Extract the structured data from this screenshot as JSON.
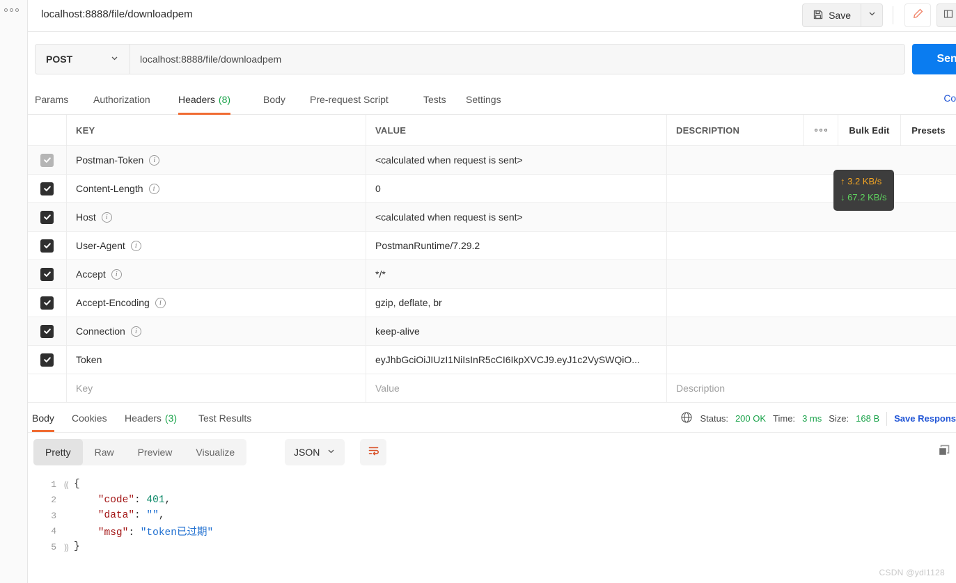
{
  "window": {
    "tab_title": "localhost:8888/file/downloadpem",
    "save_label": "Save"
  },
  "request": {
    "method": "POST",
    "url": "localhost:8888/file/downloadpem",
    "send_label": "Send",
    "tabs": [
      {
        "label": "Params",
        "active": false
      },
      {
        "label": "Authorization",
        "active": false
      },
      {
        "label": "Headers",
        "count": "(8)",
        "active": true
      },
      {
        "label": "Body",
        "active": false
      },
      {
        "label": "Pre-request Script",
        "active": false
      },
      {
        "label": "Tests",
        "active": false
      },
      {
        "label": "Settings",
        "active": false
      }
    ],
    "cookies_link": "Coo"
  },
  "headers_table": {
    "columns": {
      "key": "KEY",
      "value": "VALUE",
      "description": "DESCRIPTION",
      "bulk_edit": "Bulk Edit",
      "presets": "Presets"
    },
    "rows": [
      {
        "checked": true,
        "dim": true,
        "info": true,
        "key": "Postman-Token",
        "value": "<calculated when request is sent>",
        "description": ""
      },
      {
        "checked": true,
        "dim": false,
        "info": true,
        "key": "Content-Length",
        "value": "0",
        "description": ""
      },
      {
        "checked": true,
        "dim": false,
        "info": true,
        "key": "Host",
        "value": "<calculated when request is sent>",
        "description": ""
      },
      {
        "checked": true,
        "dim": false,
        "info": true,
        "key": "User-Agent",
        "value": "PostmanRuntime/7.29.2",
        "description": ""
      },
      {
        "checked": true,
        "dim": false,
        "info": true,
        "key": "Accept",
        "value": "*/*",
        "description": ""
      },
      {
        "checked": true,
        "dim": false,
        "info": true,
        "key": "Accept-Encoding",
        "value": "gzip, deflate, br",
        "description": ""
      },
      {
        "checked": true,
        "dim": false,
        "info": true,
        "key": "Connection",
        "value": "keep-alive",
        "description": ""
      },
      {
        "checked": true,
        "dim": false,
        "info": false,
        "key": "Token",
        "value": "eyJhbGciOiJIUzI1NiIsInR5cCI6IkpXVCJ9.eyJ1c2VySWQiO...",
        "description": ""
      }
    ],
    "placeholder_row": {
      "key": "Key",
      "value": "Value",
      "description": "Description"
    }
  },
  "network_tooltip": {
    "upload": "3.2 KB/s",
    "download": "67.2 KB/s",
    "upload_color": "#f5a623",
    "download_color": "#5fd35f"
  },
  "response": {
    "tabs": [
      {
        "label": "Body",
        "active": true
      },
      {
        "label": "Cookies",
        "active": false
      },
      {
        "label": "Headers",
        "count": "(3)",
        "active": false
      },
      {
        "label": "Test Results",
        "active": false
      }
    ],
    "status_label": "Status:",
    "status_value": "200 OK",
    "time_label": "Time:",
    "time_value": "3 ms",
    "size_label": "Size:",
    "size_value": "168 B",
    "save_response": "Save Respons",
    "view_modes": [
      {
        "label": "Pretty",
        "active": true
      },
      {
        "label": "Raw",
        "active": false
      },
      {
        "label": "Preview",
        "active": false
      },
      {
        "label": "Visualize",
        "active": false
      }
    ],
    "format": "JSON",
    "body_lines": [
      {
        "num": "1",
        "fold": "⸨",
        "segments": [
          {
            "t": "{",
            "c": "p"
          }
        ]
      },
      {
        "num": "2",
        "fold": "",
        "segments": [
          {
            "t": "    \"code\"",
            "c": "k"
          },
          {
            "t": ": ",
            "c": "p"
          },
          {
            "t": "401",
            "c": "n"
          },
          {
            "t": ",",
            "c": "p"
          }
        ]
      },
      {
        "num": "3",
        "fold": "",
        "segments": [
          {
            "t": "    \"data\"",
            "c": "k"
          },
          {
            "t": ": ",
            "c": "p"
          },
          {
            "t": "\"\"",
            "c": "s"
          },
          {
            "t": ",",
            "c": "p"
          }
        ]
      },
      {
        "num": "4",
        "fold": "",
        "segments": [
          {
            "t": "    \"msg\"",
            "c": "k"
          },
          {
            "t": ": ",
            "c": "p"
          },
          {
            "t": "\"token已过期\"",
            "c": "s"
          }
        ]
      },
      {
        "num": "5",
        "fold": "⸩",
        "segments": [
          {
            "t": "}",
            "c": "p"
          }
        ]
      }
    ]
  },
  "watermark": "CSDN @ydl1128"
}
